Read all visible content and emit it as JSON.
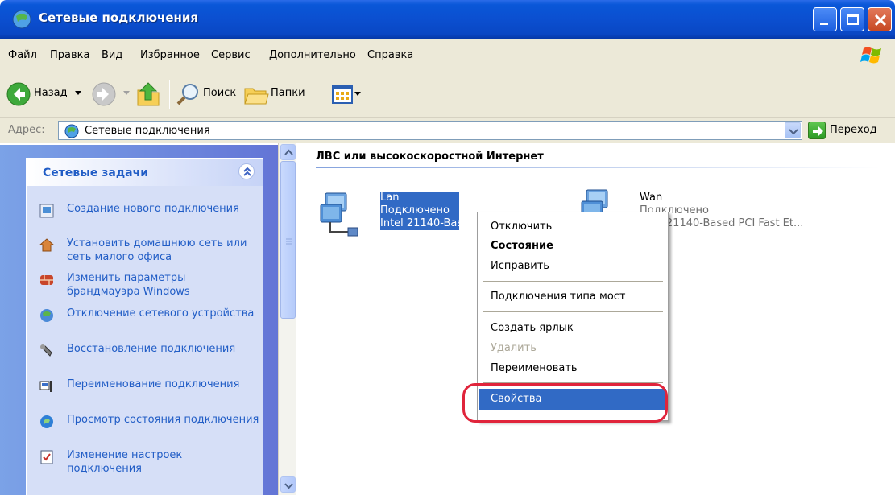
{
  "window": {
    "title": "Сетевые подключения"
  },
  "menu": {
    "items": [
      "Файл",
      "Правка",
      "Вид",
      "Избранное",
      "Сервис",
      "Дополнительно",
      "Справка"
    ]
  },
  "toolbar": {
    "back_label": "Назад",
    "search_label": "Поиск",
    "folders_label": "Папки"
  },
  "address": {
    "label": "Адрес:",
    "value": "Сетевые подключения",
    "go_label": "Переход"
  },
  "tasks": {
    "header": "Сетевые задачи",
    "items": [
      {
        "label": "Создание нового подключения",
        "icon": "new-connection-icon"
      },
      {
        "label": "Установить домашнюю сеть или сеть малого офиса",
        "icon": "home-network-icon"
      },
      {
        "label": "Изменить параметры брандмауэра Windows",
        "icon": "firewall-icon"
      },
      {
        "label": "Отключение сетевого устройства",
        "icon": "disable-device-icon"
      },
      {
        "label": "Восстановление подключения",
        "icon": "repair-icon"
      },
      {
        "label": "Переименование подключения",
        "icon": "rename-icon"
      },
      {
        "label": "Просмотр состояния подключения",
        "icon": "status-icon"
      },
      {
        "label": "Изменение настроек подключения",
        "icon": "settings-icon"
      }
    ]
  },
  "content": {
    "group_title": "ЛВС или высокоскоростной Интернет",
    "connections": [
      {
        "name": "Lan",
        "status": "Подключено",
        "device": "Intel 21140-Bas"
      },
      {
        "name": "Wan",
        "status": "Подключено",
        "device": "Intel 21140-Based PCI Fast Et..."
      }
    ]
  },
  "context_menu": {
    "disconnect": "Отключить",
    "status": "Состояние",
    "repair": "Исправить",
    "bridge": "Подключения типа мост",
    "shortcut": "Создать ярлык",
    "delete": "Удалить",
    "rename": "Переименовать",
    "properties": "Свойства"
  },
  "colors": {
    "title_bar": "#0b4fd0",
    "selection": "#316ac5",
    "highlight_oval": "#e0243b",
    "task_link": "#215dc6"
  }
}
